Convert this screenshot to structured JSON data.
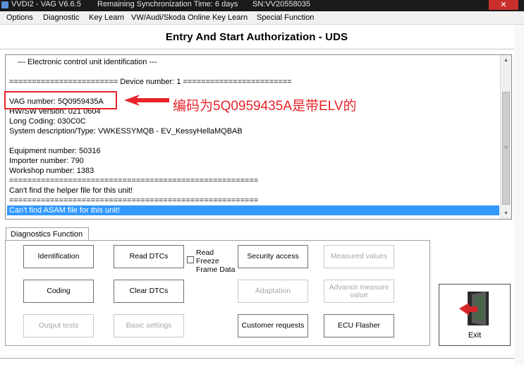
{
  "window": {
    "title": "VVDI2 - VAG V6.6.5",
    "sync_text": "Remaining Synchronization Time: 6 days",
    "serial": "SN:VV20558035",
    "close_symbol": "✕"
  },
  "menu": [
    "Options",
    "Diagnostic",
    "Key Learn",
    "VW/Audi/Skoda Online Key Learn",
    "Special Function"
  ],
  "header": {
    "title": "Entry And Start Authorization  -  UDS"
  },
  "output": {
    "lines": [
      "--- Electronic control unit identification ---",
      "",
      "======================== Device number: 1 ========================",
      "",
      "VAG number: 5Q0959435A",
      "HW/SW version: 021 0604",
      "Long Coding: 030C0C",
      "System description/Type: VWKESSYMQB    - EV_KessyHellaMQBAB",
      "",
      "Equipment number: 50316",
      "Importer number: 790",
      "Workshop number: 1383",
      "=======================================================",
      "Can't find the helper file for this unit!",
      "=======================================================",
      "Can't find ASAM file for this unit!"
    ],
    "selected_line": "Can't find ASAM file for this unit!"
  },
  "annotation": {
    "text": "编码为5Q0959435A是带ELV的",
    "color": "#e8232a"
  },
  "diagnostics": {
    "tab_label": "Diagnostics Function",
    "buttons": {
      "identification": "Identification",
      "read_dtcs": "Read DTCs",
      "security_access": "Security access",
      "measured_values": "Measured values",
      "coding": "Coding",
      "clear_dtcs": "Clear DTCs",
      "adaptation": "Adaptation",
      "advance_measure": "Advance measure value",
      "output_tests": "Output tests",
      "basic_settings": "Basic settings",
      "customer_requests": "Customer requests",
      "ecu_flasher": "ECU Flasher"
    },
    "freeze_frame_label": "Read Freeze Frame Data",
    "freeze_frame_checked": false
  },
  "exit_label": "Exit",
  "colors": {
    "selection": "#3399ff",
    "annotation": "#e8232a",
    "disabled_text": "#a6a6a6"
  }
}
